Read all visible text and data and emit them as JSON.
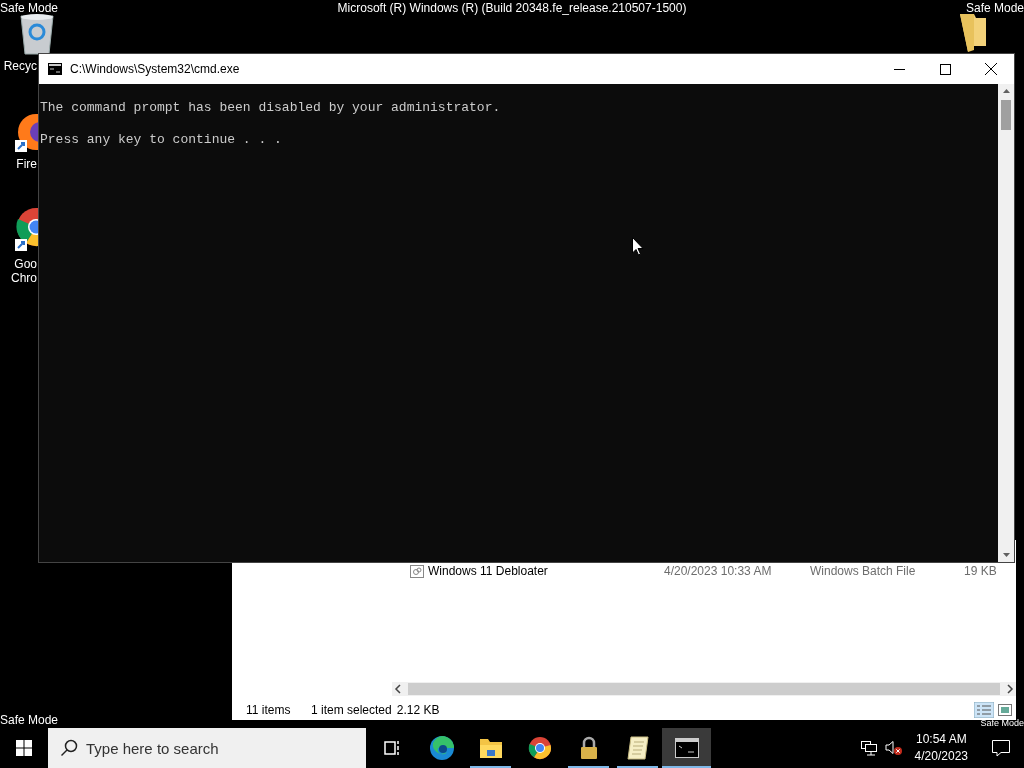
{
  "desktop": {
    "build_text": "Microsoft (R) Windows (R) (Build 20348.fe_release.210507-1500)",
    "safe_mode_labels": [
      "Safe Mode",
      "Safe Mode",
      "Safe Mode",
      "Safe Mode"
    ],
    "icons": [
      {
        "kind": "recycle",
        "lines": [
          "Recyc"
        ]
      },
      {
        "kind": "firefox",
        "lines": [
          "Fire"
        ]
      },
      {
        "kind": "chrome",
        "lines": [
          "Goo",
          "Chro"
        ]
      },
      {
        "kind": "folder"
      }
    ]
  },
  "cmd_window": {
    "title": "C:\\Windows\\System32\\cmd.exe",
    "lines": [
      "The command prompt has been disabled by your administrator.",
      "Press any key to continue . . ."
    ]
  },
  "explorer": {
    "rows": [
      {
        "name": "Windows 11 Debloater",
        "date": "4/20/2023 10:33 AM",
        "type": "Windows Batch File",
        "size": "19 KB"
      }
    ],
    "status_bar": {
      "items": "11 items",
      "selection": "1 item selected",
      "size": "2.12 KB"
    }
  },
  "taskbar": {
    "search": {
      "placeholder": "Type here to search"
    },
    "apps": [
      {
        "kind": "taskview",
        "running": false,
        "selected": false
      },
      {
        "kind": "edge",
        "running": false,
        "selected": false
      },
      {
        "kind": "explorer",
        "running": true,
        "selected": false
      },
      {
        "kind": "chrome",
        "running": false,
        "selected": false
      },
      {
        "kind": "lock",
        "running": true,
        "selected": false
      },
      {
        "kind": "notepad",
        "running": true,
        "selected": false
      },
      {
        "kind": "cmd",
        "running": true,
        "selected": true
      }
    ],
    "clock": {
      "time": "10:54 AM",
      "date": "4/20/2023"
    }
  }
}
